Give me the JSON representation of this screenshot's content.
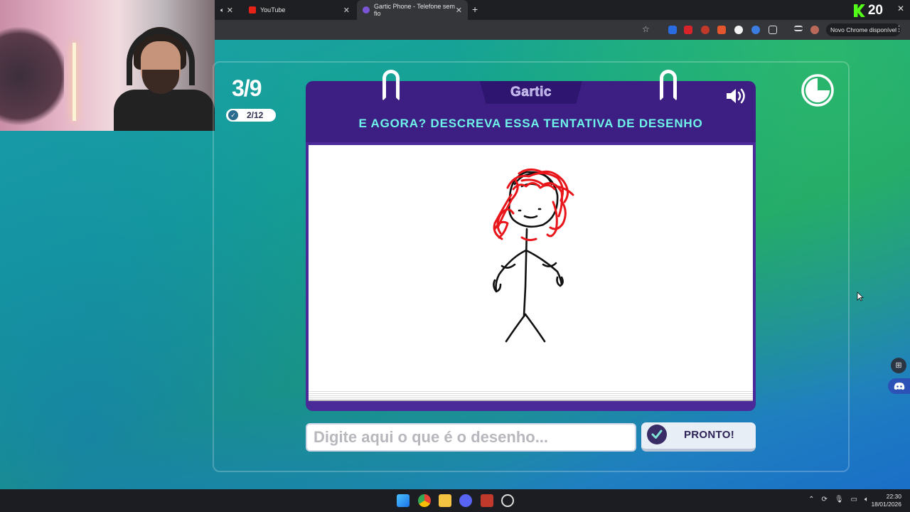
{
  "browser": {
    "tabs": [
      {
        "label": "",
        "icon": "speaker-icon"
      },
      {
        "label": "YouTube",
        "icon": "youtube-icon"
      },
      {
        "label": "Gartic Phone - Telefone sem fio",
        "icon": "phone-icon",
        "active": true
      }
    ],
    "update_label": "Novo Chrome disponível",
    "kick_viewers": "20"
  },
  "game": {
    "round": "3/9",
    "players_done": "2/12",
    "logo": "Gartic",
    "instruction": "E AGORA? DESCREVA ESSA TENTATIVA DE DESENHO",
    "input_placeholder": "Digite aqui o que é o desenho...",
    "ready_label": "PRONTO!",
    "timer_fraction_elapsed": 0.25
  },
  "taskbar": {
    "time": "22:30",
    "date": "18/01/2026"
  },
  "colors": {
    "card_header": "#3d1f84",
    "instruction_text": "#6ef3e8",
    "hair_red": "#e8151a",
    "kick_green": "#53fc18"
  }
}
